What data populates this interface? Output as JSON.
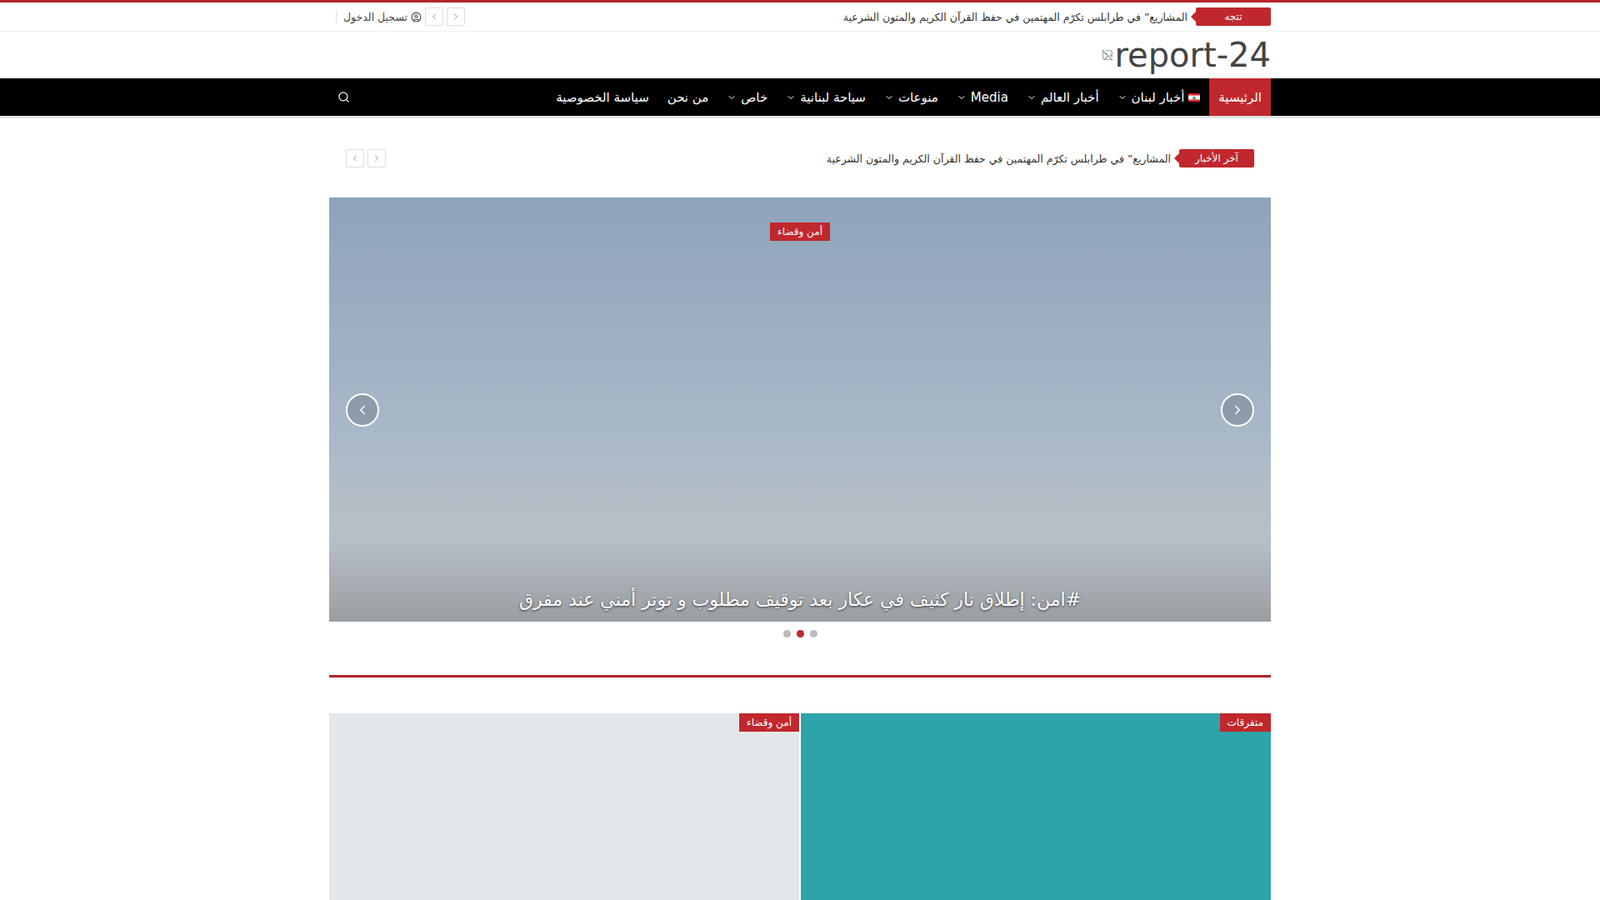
{
  "topbar": {
    "trending_label": "تتجه",
    "trending_text": "المشاريع” في طرابلس تكرّم المهتمين في حفظ القرآن الكريم والمتون الشرعية",
    "login": "تسجيل الدخول"
  },
  "logo": {
    "text": "report-24"
  },
  "nav": {
    "items": [
      {
        "label": "الرئيسية",
        "selected": true,
        "dropdown": false,
        "flag": false
      },
      {
        "label": "أخبار لبنان",
        "selected": false,
        "dropdown": true,
        "flag": true
      },
      {
        "label": "أخبار العالم",
        "selected": false,
        "dropdown": true,
        "flag": false
      },
      {
        "label": "Media",
        "selected": false,
        "dropdown": true,
        "flag": false
      },
      {
        "label": "منوعات",
        "selected": false,
        "dropdown": true,
        "flag": false
      },
      {
        "label": "سياحة لبنانية",
        "selected": false,
        "dropdown": true,
        "flag": false
      },
      {
        "label": "خاص",
        "selected": false,
        "dropdown": true,
        "flag": false
      },
      {
        "label": "من نحن",
        "selected": false,
        "dropdown": false,
        "flag": false
      },
      {
        "label": "سياسة الخصوصية",
        "selected": false,
        "dropdown": false,
        "flag": false
      }
    ]
  },
  "breaking": {
    "label": "آخر الأخبار",
    "text": "المشاريع” في طرابلس تكرّم المهتمين في حفظ القرآن الكريم والمتون الشرعية"
  },
  "slider": {
    "category": "أمن وقضاء",
    "title": "#امن: إطلاق نار كثيف في عكار بعد توقيف مطلوب و توتر أمني عند مفرق",
    "dots": [
      {
        "selected": false
      },
      {
        "selected": true
      },
      {
        "selected": false
      }
    ]
  },
  "cards": [
    {
      "category": "متفرقات",
      "color": "#2fa4a8"
    },
    {
      "category": "أمن وقضاء",
      "color": "#e4e7e9"
    }
  ]
}
